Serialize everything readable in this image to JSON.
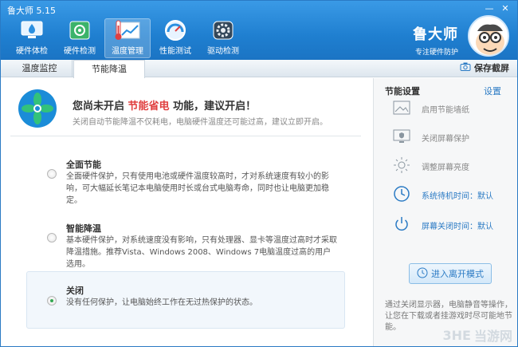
{
  "app": {
    "title": "鲁大师 5.15",
    "window_buttons": [
      "—",
      "✕"
    ]
  },
  "toolbar": {
    "items": [
      {
        "label": "硬件体检",
        "icon": "monitor-drop-icon"
      },
      {
        "label": "硬件检测",
        "icon": "circuit-board-icon"
      },
      {
        "label": "温度管理",
        "icon": "thermometer-chart-icon",
        "active": true
      },
      {
        "label": "性能测试",
        "icon": "speedometer-icon"
      },
      {
        "label": "驱动检测",
        "icon": "gear-box-icon"
      }
    ]
  },
  "brand": {
    "name": "鲁大师",
    "slogan": "专注硬件防护",
    "mascot": "mascot-avatar"
  },
  "subtabs": {
    "tab1": "温度监控",
    "tab2": "节能降温",
    "save_screenshot": "保存截屏"
  },
  "main": {
    "hero_title_part1": "您尚未开启 ",
    "hero_title_highlight": "节能省电",
    "hero_title_part2": " 功能，建议开启！",
    "hero_subtitle": "关闭自动节能降温不仅耗电，电脑硬件温度还可能过高，建议立即开启。",
    "options": [
      {
        "title": "全面节能",
        "desc": "全面硬件保护，只有使用电池或硬件温度较高时，才对系统速度有较小的影响，可大幅延长笔记本电脑使用时长或台式电脑寿命，同时也让电脑更加稳定。",
        "selected": false
      },
      {
        "title": "智能降温",
        "desc": "基本硬件保护，对系统速度没有影响，只有处理器、显卡等温度过高时才采取降温措施。推荐Vista、Windows 2008、Windows 7电脑温度过高的用户选用。",
        "selected": false
      },
      {
        "title": "关闭",
        "desc": "没有任何保护，让电脑始终工作在无过热保护的状态。",
        "selected": true
      }
    ]
  },
  "side": {
    "title": "节能设置",
    "settings_link": "设置",
    "items": [
      {
        "label": "启用节能墙纸",
        "icon": "image-icon"
      },
      {
        "label": "关闭屏幕保护",
        "icon": "screen-shield-icon"
      },
      {
        "label": "调整屏幕亮度",
        "icon": "brightness-icon"
      },
      {
        "label": "系统待机时间：默认",
        "icon": "clock-icon",
        "blue": true
      },
      {
        "label": "屏幕关闭时间：默认",
        "icon": "power-icon",
        "blue": true
      }
    ],
    "leave_button": "进入离开模式",
    "note": "通过关闭显示器，电脑静音等操作，让您在下载或者挂游戏时尽可能地节能。"
  },
  "watermark": {
    "text": "当游网",
    "logo": "3HE"
  },
  "colors": {
    "accent": "#1f7fd0",
    "highlight": "#e04040",
    "link": "#2a7ac4",
    "radio_on": "#34a853"
  }
}
